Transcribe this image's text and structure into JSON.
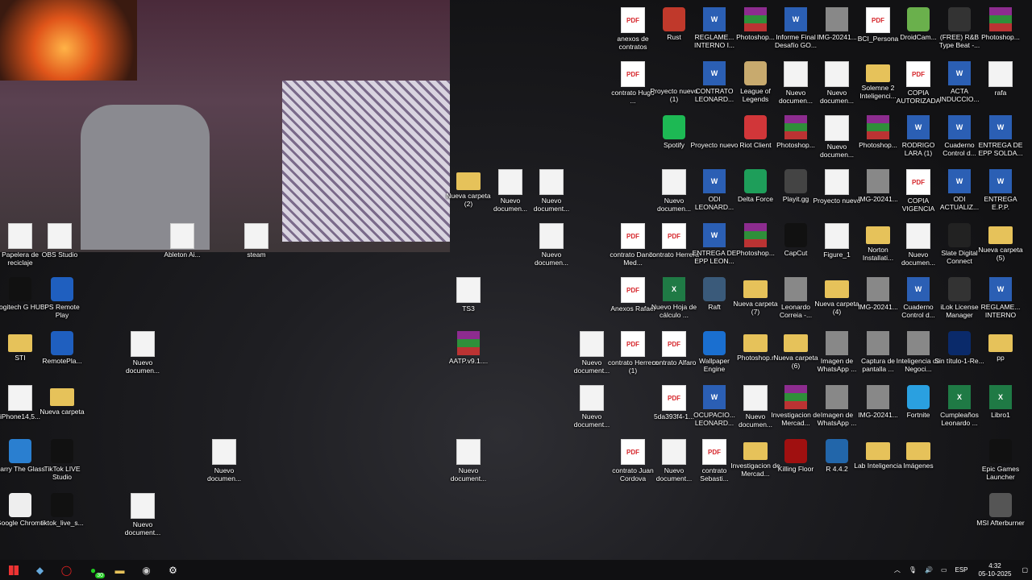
{
  "desktop": {
    "icons": [
      {
        "label": "anexos de contratos",
        "type": "pdf"
      },
      {
        "label": "Rust",
        "type": "app",
        "color": "#c0392b"
      },
      {
        "label": "REGLAME... INTERNO I...",
        "type": "word"
      },
      {
        "label": "Photoshop...",
        "type": "rar"
      },
      {
        "label": "Informe Final Desafío GO...",
        "type": "word"
      },
      {
        "label": "IMG-20241...",
        "type": "img"
      },
      {
        "label": "BCI_Persona",
        "type": "pdf"
      },
      {
        "label": "DroidCam...",
        "type": "app",
        "color": "#6ab04c"
      },
      {
        "label": "(FREE) R&B Type Beat -...",
        "type": "app",
        "color": "#333333"
      },
      {
        "label": "Photoshop...",
        "type": "rar"
      },
      {
        "label": "contrato Hugo ...",
        "type": "pdf"
      },
      {
        "label": "Proyecto nuevo (1)",
        "type": "blank"
      },
      {
        "label": "CONTRATO LEONARD...",
        "type": "word"
      },
      {
        "label": "League of Legends",
        "type": "app",
        "color": "#c8aa6e"
      },
      {
        "label": "Nuevo documen...",
        "type": "file"
      },
      {
        "label": "Nuevo documen...",
        "type": "file"
      },
      {
        "label": "Solemne 2 Inteligenci...",
        "type": "folder"
      },
      {
        "label": "COPIA AUTORIZADA",
        "type": "pdf"
      },
      {
        "label": "ACTA INDUCCIO...",
        "type": "word"
      },
      {
        "label": "rafa",
        "type": "file"
      },
      {
        "label": "Spotify",
        "type": "app",
        "color": "#1db954"
      },
      {
        "label": "Proyecto nuevo",
        "type": "blank"
      },
      {
        "label": "Riot Client",
        "type": "app",
        "color": "#d13639"
      },
      {
        "label": "Photoshop...",
        "type": "rar"
      },
      {
        "label": "Nuevo documen...",
        "type": "file"
      },
      {
        "label": "Photoshop...",
        "type": "rar"
      },
      {
        "label": "RODRIGO LARA (1)",
        "type": "word"
      },
      {
        "label": "Cuaderno Control d...",
        "type": "word"
      },
      {
        "label": "ENTREGA DE EPP SOLDA...",
        "type": "word"
      },
      {
        "label": "Nueva carpeta (2)",
        "type": "folder"
      },
      {
        "label": "Nuevo documen...",
        "type": "file"
      },
      {
        "label": "Nuevo document...",
        "type": "file"
      },
      {
        "label": "Nuevo documen...",
        "type": "file"
      },
      {
        "label": "ODI LEONARD...",
        "type": "word"
      },
      {
        "label": "Delta Force",
        "type": "app",
        "color": "#1e9e5a"
      },
      {
        "label": "Playit.gg",
        "type": "app",
        "color": "#444444"
      },
      {
        "label": "Proyecto nuevo",
        "type": "file"
      },
      {
        "label": "IMG-20241...",
        "type": "img"
      },
      {
        "label": "COPIA VIGENCIA",
        "type": "pdf"
      },
      {
        "label": "ODI ACTUALIZ...",
        "type": "word"
      },
      {
        "label": "ENTREGA E.P.P.",
        "type": "word"
      },
      {
        "label": "Nuevo documen...",
        "type": "file"
      },
      {
        "label": "contrato Danilo Med...",
        "type": "pdf"
      },
      {
        "label": "contrato Herrera",
        "type": "pdf"
      },
      {
        "label": "ENTREGA DE EPP LEON...",
        "type": "word"
      },
      {
        "label": "Photoshop...",
        "type": "rar"
      },
      {
        "label": "CapCut",
        "type": "app",
        "color": "#111111"
      },
      {
        "label": "Figure_1",
        "type": "file"
      },
      {
        "label": "Norton Installati...",
        "type": "folder"
      },
      {
        "label": "Nuevo documen...",
        "type": "file"
      },
      {
        "label": "Slate Digital Connect",
        "type": "app",
        "color": "#222222"
      },
      {
        "label": "Nueva carpeta (5)",
        "type": "folder"
      },
      {
        "label": "TS3",
        "type": "file"
      },
      {
        "label": "Anexos Rafael",
        "type": "pdf"
      },
      {
        "label": "Nuevo Hoja de cálculo ...",
        "type": "excel"
      },
      {
        "label": "Raft",
        "type": "app",
        "color": "#3a5a7a"
      },
      {
        "label": "Nueva carpeta (7)",
        "type": "folder"
      },
      {
        "label": "Leonardo Correia -...",
        "type": "img"
      },
      {
        "label": "Nueva carpeta (4)",
        "type": "folder"
      },
      {
        "label": "IMG-20241...",
        "type": "img"
      },
      {
        "label": "Cuaderno Control d...",
        "type": "word"
      },
      {
        "label": "iLok License Manager",
        "type": "app",
        "color": "#333333"
      },
      {
        "label": "REGLAME... INTERNO",
        "type": "word"
      },
      {
        "label": "AATP.v9.1....",
        "type": "rar"
      },
      {
        "label": "Nuevo document...",
        "type": "file"
      },
      {
        "label": "contrato Herrera (1)",
        "type": "pdf"
      },
      {
        "label": "contrato Alfaro",
        "type": "pdf"
      },
      {
        "label": "Wallpaper Engine",
        "type": "app",
        "color": "#1a6fd0"
      },
      {
        "label": "Photoshop.r",
        "type": "folder"
      },
      {
        "label": "Nueva carpeta (6)",
        "type": "folder"
      },
      {
        "label": "Imagen de WhatsApp ...",
        "type": "img"
      },
      {
        "label": "Captura de pantalla ...",
        "type": "img"
      },
      {
        "label": "Inteligencia de Negoci...",
        "type": "img"
      },
      {
        "label": "Sin título-1-Re...",
        "type": "app",
        "color": "#0a2a6a"
      },
      {
        "label": "pp",
        "type": "folder"
      },
      {
        "label": "Nuevo document...",
        "type": "file"
      },
      {
        "label": "5da393f4-1...",
        "type": "pdf"
      },
      {
        "label": "OCUPACIO... LEONARD...",
        "type": "word"
      },
      {
        "label": "Nuevo documen...",
        "type": "file"
      },
      {
        "label": "Investigacion de Mercad...",
        "type": "rar"
      },
      {
        "label": "Imagen de WhatsApp ...",
        "type": "img"
      },
      {
        "label": "IMG-20241...",
        "type": "img"
      },
      {
        "label": "Fortnite",
        "type": "app",
        "color": "#2aa0e0"
      },
      {
        "label": "Cumpleaños Leonardo ...",
        "type": "excel"
      },
      {
        "label": "Libro1",
        "type": "excel"
      },
      {
        "label": "Nuevo document...",
        "type": "file"
      },
      {
        "label": "contrato Juan Cordova",
        "type": "pdf"
      },
      {
        "label": "Nuevo document...",
        "type": "file"
      },
      {
        "label": "contrato Sebasti...",
        "type": "pdf"
      },
      {
        "label": "Investigacion de Mercad...",
        "type": "folder"
      },
      {
        "label": "Killing Floor",
        "type": "app",
        "color": "#a01010"
      },
      {
        "label": "R 4.4.2",
        "type": "app",
        "color": "#2266aa"
      },
      {
        "label": "Lab Inteligencia",
        "type": "folder"
      },
      {
        "label": "Imágenes",
        "type": "folder"
      },
      {
        "label": "Epic Games Launcher",
        "type": "app",
        "color": "#111111"
      },
      {
        "label": "MSI Afterburner",
        "type": "app",
        "color": "#555555"
      },
      {
        "label": "Papelera de reciclaje",
        "type": "file"
      },
      {
        "label": "OBS Studio",
        "type": "file"
      },
      {
        "label": "Ableton Ai...",
        "type": "file"
      },
      {
        "label": "steam",
        "type": "file"
      },
      {
        "label": "Logitech G HUB",
        "type": "app",
        "color": "#111111"
      },
      {
        "label": "PS Remote Play",
        "type": "app",
        "color": "#1f5fbf"
      },
      {
        "label": "STI",
        "type": "folder"
      },
      {
        "label": "RemotePla...",
        "type": "app",
        "color": "#1f5fbf"
      },
      {
        "label": "Nuevo documen...",
        "type": "file"
      },
      {
        "label": "iPhone14,5...",
        "type": "file"
      },
      {
        "label": "Nueva carpeta",
        "type": "folder"
      },
      {
        "label": "Carry The Glass",
        "type": "app",
        "color": "#2a7fd0"
      },
      {
        "label": "TikTok LIVE Studio",
        "type": "app",
        "color": "#111111"
      },
      {
        "label": "Nuevo documen...",
        "type": "file"
      },
      {
        "label": "Google Chrome",
        "type": "app",
        "color": "#eeeeee"
      },
      {
        "label": "tiktok_live_s...",
        "type": "app",
        "color": "#111111"
      },
      {
        "label": "Nuevo document...",
        "type": "file"
      }
    ]
  },
  "taskbar": {
    "whatsapp_badge": "30",
    "language": "ESP",
    "time": "4:32",
    "date": "05-10-2025"
  }
}
